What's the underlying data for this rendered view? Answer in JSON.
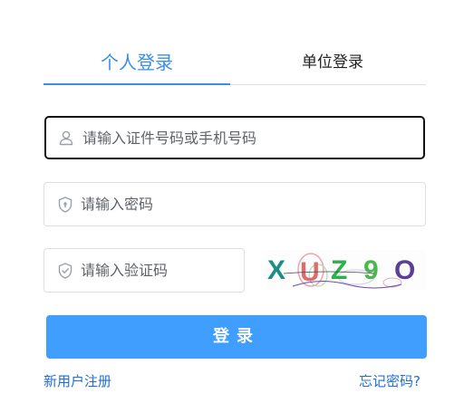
{
  "tabs": [
    {
      "label": "个人登录",
      "active": true
    },
    {
      "label": "单位登录",
      "active": false
    }
  ],
  "form": {
    "account_placeholder": "请输入证件号码或手机号码",
    "password_placeholder": "请输入密码",
    "captcha_placeholder": "请输入验证码",
    "captcha_text": "XUZ9O"
  },
  "login_label": "登录",
  "links": {
    "register": "新用户注册",
    "forgot": "忘记密码?"
  },
  "icons": {
    "account": "user-icon",
    "password": "shield-lock-icon",
    "captcha": "shield-check-icon"
  },
  "colors": {
    "accent": "#409eff",
    "tab_active": "#3a8ee6",
    "link": "#1f6fd6"
  }
}
